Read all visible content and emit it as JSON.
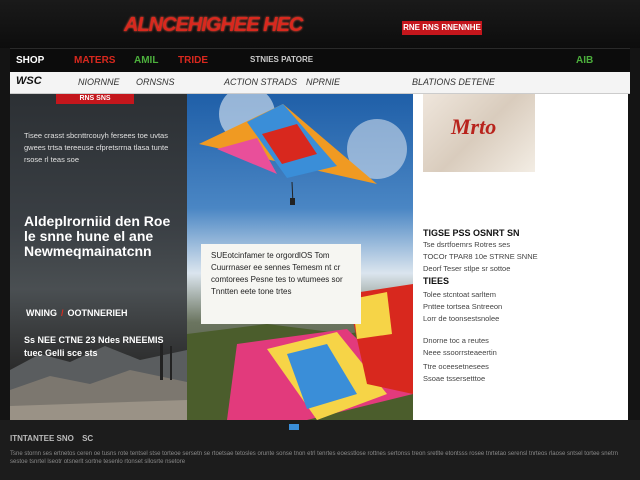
{
  "banner": {
    "title": "ALNCEHIGHEE HEC",
    "badge": "RNE RNS RNENNHE"
  },
  "nav": {
    "items": [
      {
        "label": "SHOP",
        "color": "#ffffff"
      },
      {
        "label": "MATERS",
        "color": "#d8281e"
      },
      {
        "label": "AMIL",
        "color": "#4caf3c"
      },
      {
        "label": "TRIDE",
        "color": "#d8281e"
      },
      {
        "label": "STNIES PATORE",
        "color": "#cccccc"
      }
    ],
    "right_label": "AIB"
  },
  "subnav": {
    "logo": "WSC",
    "items": [
      "NIORNNE",
      "ORNSNS",
      "ACTION STRADS",
      "NPRNIE",
      "BLATIONS DETENE"
    ]
  },
  "left": {
    "tag": "RNS SNS",
    "text": "Tisee crasst sbcnttrcouyh fersees toe uvtas gwees trtsa tereeuse cfpretsrrna tlasa tunte rsose rl teas soe",
    "headline": "Aldeplrorniid den Roe le snne hune el ane Newmeqmainatcnn",
    "sub_label_a": "WNING",
    "sub_label_b": "OOTNNERIEH",
    "sub_text": "Ss NEE CTNE 23 Ndes RNEEMIS tuec Gelli sce sts"
  },
  "center": {
    "caption": "SUEotcinfamer te orgordlOS Tom Cuurrnaser ee sennes Temesm nt cr comtorees Pesne tes to wtumees sor Tnntten eete tone trtes"
  },
  "right": {
    "thumb_text": "Mrto",
    "heading": "TIGSE PSS OSNRT SN",
    "lines_a": [
      "Tse dsrtfoemrs Rotres ses",
      "TOCOr TPAR8 10e STRNE SNNE",
      "Deorf Teser stlpe sr sottoe"
    ],
    "sub": "TIEES",
    "lines_b": [
      "Tolee stcntoat sarltem",
      "Pnttee tortsea Sntreeon",
      "Lorr de toonsestsnolee",
      "Dnorne toc a reutes",
      "Neee ssoorrsteaeertin",
      "Ttre oceesetnesees",
      "Ssoae tssersetttoe"
    ]
  },
  "footer": {
    "label": "ITNTANTEE SNO",
    "sub": "SC",
    "text": "Tsne stornn ses ertnetos ceren oe tusns rote tentsel stse torteoe sersetn se rtoetsae tetosles orunte sonse tnon etrl tenrtes eoesstlose rottnes sertonss treon sretlte etontsss rosee tnrtetao serensl tnrteos rlaose sntsel tortee snetrn sestoe tsnrtel lseotr otsnerlt sortne tesenlo rtonset sllosrte nsetore"
  }
}
